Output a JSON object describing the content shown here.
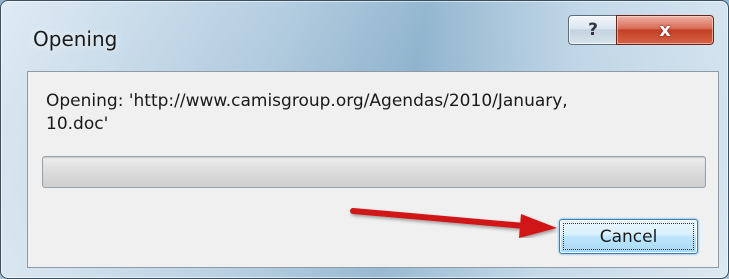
{
  "window": {
    "title": "Opening",
    "help_symbol": "?",
    "close_symbol": "x"
  },
  "dialog": {
    "message": "Opening: 'http://www.camisgroup.org/Agendas/2010/January,\n10.doc'",
    "progress_fraction": 0,
    "cancel_label": "Cancel"
  },
  "annotation": {
    "arrow_color": "#d01818",
    "points_to": "cancel-button"
  }
}
